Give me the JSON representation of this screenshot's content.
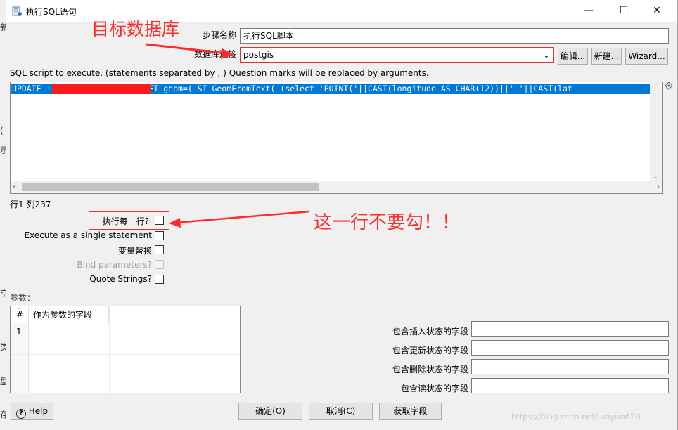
{
  "window": {
    "title": "执行SQL语句",
    "minimize": "—",
    "maximize": "☐",
    "close": "✕"
  },
  "form": {
    "step_name_label": "步骤名称",
    "step_name_value": "执行SQL脚本",
    "connection_label": "数据库连接",
    "connection_value": "postgis",
    "edit_button": "编辑...",
    "new_button": "新建...",
    "wizard_button": "Wizard...",
    "sql_hint": "SQL script to execute. (statements separated by ; ) Question marks will be replaced by arguments.",
    "sql_text_start": "UPDATE",
    "sql_text_rest": "SET geom=( ST_GeomFromText( (select 'POINT('||CAST(longitude AS CHAR(12))||' '||CAST(lat",
    "position": "行1 列237"
  },
  "options": {
    "exec_each_row": "执行每一行?",
    "single_statement": "Execute as a single statement",
    "variable_substitution": "变量替换",
    "bind_parameters": "Bind parameters?",
    "quote_strings": "Quote Strings?"
  },
  "params": {
    "label": "参数：",
    "col_num": "#",
    "col_field": "作为参数的字段",
    "rows": [
      "1"
    ]
  },
  "status_fields": {
    "insert": "包含插入状态的字段",
    "update": "包含更新状态的字段",
    "delete": "包含删除状态的字段",
    "read": "包含读状态的字段"
  },
  "footer": {
    "help": "Help",
    "ok": "确定(O)",
    "cancel": "取消(C)",
    "get_fields": "获取字段",
    "watermark": "https://blog.csdn.net/luoyun620"
  },
  "annotations": {
    "target_db": "目标数据库",
    "no_check": "这一行不要勾！！"
  },
  "background_fragments": [
    "新",
    "(",
    "示",
    "空",
    "类",
    "型",
    "存"
  ],
  "colors": {
    "selection": "#0078d7",
    "annotation": "#ff2a2a"
  }
}
